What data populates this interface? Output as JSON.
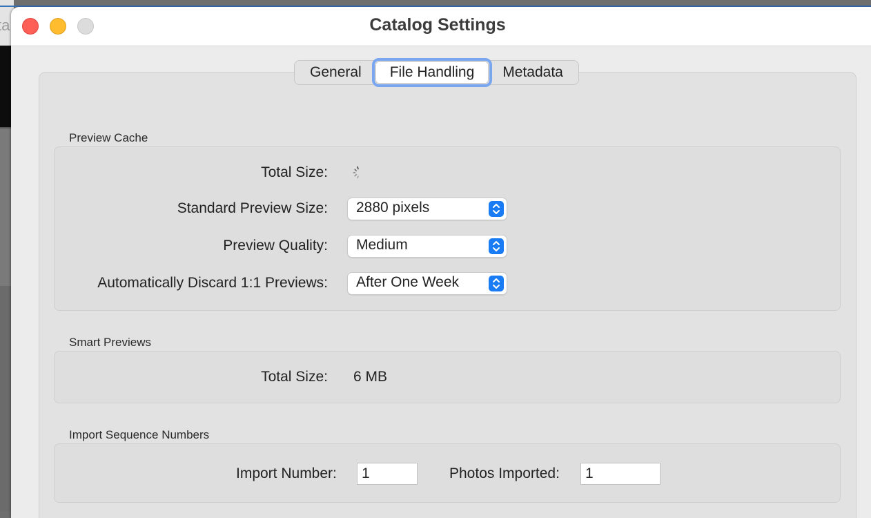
{
  "background_app": {
    "partial_text": "ta"
  },
  "window": {
    "title": "Catalog Settings"
  },
  "tabs": [
    {
      "label": "General",
      "active": false
    },
    {
      "label": "File Handling",
      "active": true
    },
    {
      "label": "Metadata",
      "active": false
    }
  ],
  "preview_cache": {
    "heading": "Preview Cache",
    "total_size_label": "Total Size:",
    "standard_preview_size": {
      "label": "Standard Preview Size:",
      "value": "2880 pixels"
    },
    "preview_quality": {
      "label": "Preview Quality:",
      "value": "Medium"
    },
    "auto_discard": {
      "label": "Automatically Discard 1:1 Previews:",
      "value": "After One Week"
    }
  },
  "smart_previews": {
    "heading": "Smart Previews",
    "total_size_label": "Total Size:",
    "total_size_value": "6 MB"
  },
  "import_sequence": {
    "heading": "Import Sequence Numbers",
    "import_number": {
      "label": "Import Number:",
      "value": "1"
    },
    "photos_imported": {
      "label": "Photos Imported:",
      "value": "1"
    }
  },
  "colors": {
    "accent": "#1a7cf5",
    "focus_ring": "#7aa6f0",
    "close": "#fe5f57",
    "minimize": "#febc2e",
    "zoom_inactive": "#dcdcdc"
  },
  "icons": {
    "close": "close-icon",
    "minimize": "minimize-icon",
    "zoom": "zoom-icon",
    "popup_arrows": "chevron-up-down-icon",
    "loading": "spinner-icon"
  }
}
